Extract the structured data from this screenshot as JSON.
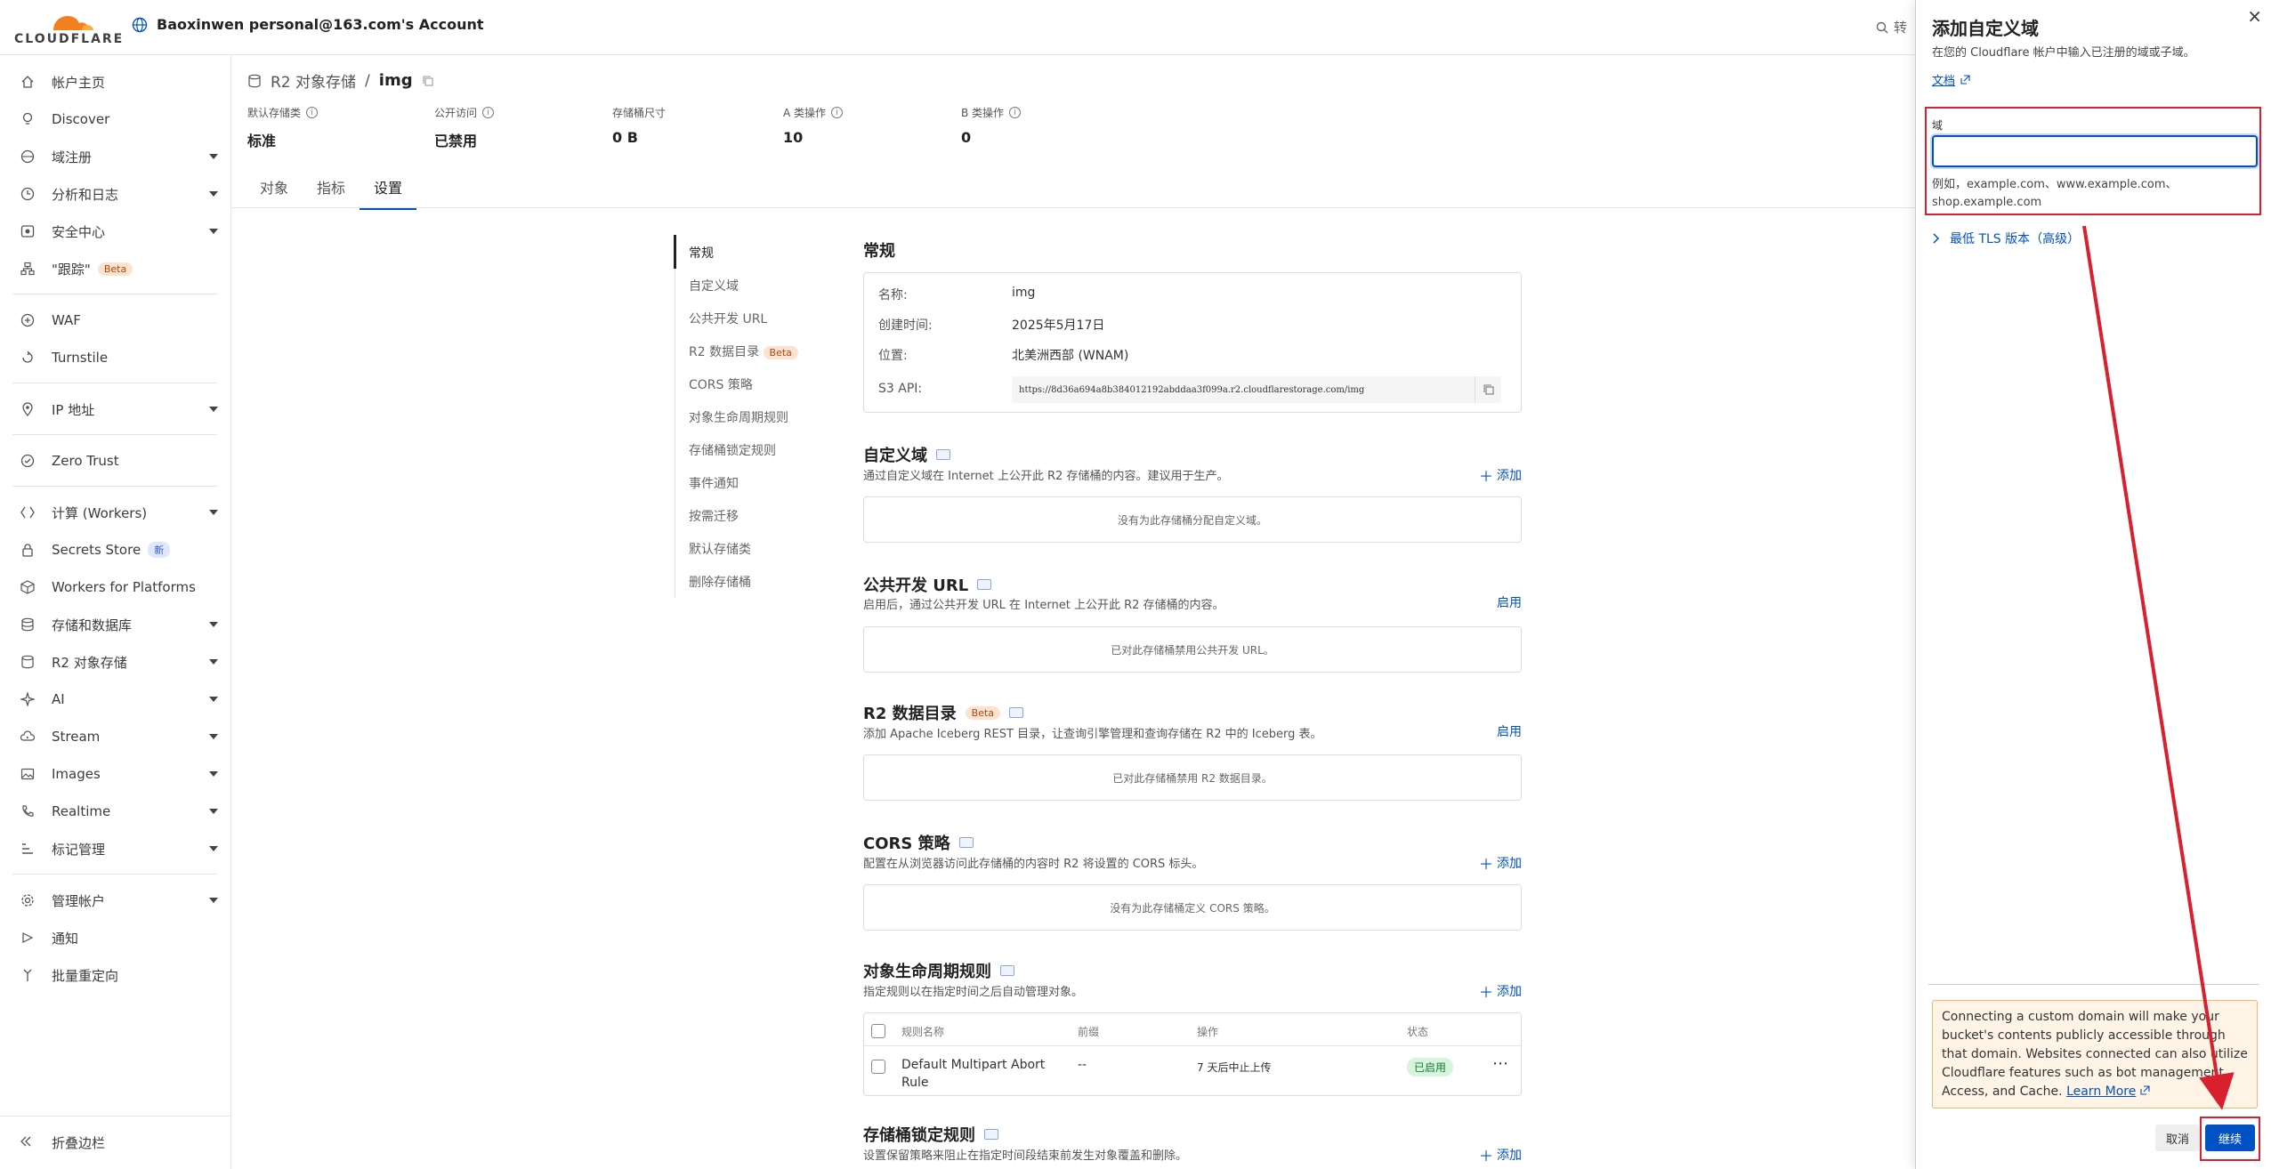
{
  "header": {
    "logo_text": "CLOUDFLARE",
    "account": "Baoxinwen personal@163.com's Account",
    "search_stub": "转"
  },
  "sidebar": {
    "items": [
      {
        "label": "帐户主页"
      },
      {
        "label": "Discover"
      },
      {
        "label": "域注册"
      },
      {
        "label": "分析和日志"
      },
      {
        "label": "安全中心"
      },
      {
        "label": "\"跟踪\"",
        "badge": "Beta"
      },
      {
        "label": "WAF"
      },
      {
        "label": "Turnstile"
      },
      {
        "label": "IP 地址"
      },
      {
        "label": "Zero Trust"
      },
      {
        "label": "计算 (Workers)"
      },
      {
        "label": "Secrets Store",
        "badge": "新"
      },
      {
        "label": "Workers for Platforms"
      },
      {
        "label": "存储和数据库"
      },
      {
        "label": "R2 对象存储"
      },
      {
        "label": "AI"
      },
      {
        "label": "Stream"
      },
      {
        "label": "Images"
      },
      {
        "label": "Realtime"
      },
      {
        "label": "标记管理"
      },
      {
        "label": "管理帐户"
      },
      {
        "label": "通知"
      },
      {
        "label": "批量重定向"
      }
    ],
    "collapse_label": "折叠边栏"
  },
  "bucket": {
    "breadcrumb_root": "R2 对象存储",
    "breadcrumb_sep": "/",
    "name": "img",
    "stats": [
      {
        "label": "默认存储类",
        "value": "标准"
      },
      {
        "label": "公开访问",
        "value": "已禁用"
      },
      {
        "label": "存储桶尺寸",
        "value": "0 B"
      },
      {
        "label": "A 类操作",
        "value": "10"
      },
      {
        "label": "B 类操作",
        "value": "0"
      }
    ],
    "tabs": [
      {
        "label": "对象"
      },
      {
        "label": "指标"
      },
      {
        "label": "设置"
      }
    ]
  },
  "settings_nav": [
    {
      "label": "常规"
    },
    {
      "label": "自定义域"
    },
    {
      "label": "公共开发 URL"
    },
    {
      "label": "R2 数据目录",
      "badge": "Beta"
    },
    {
      "label": "CORS 策略"
    },
    {
      "label": "对象生命周期规则"
    },
    {
      "label": "存储桶锁定规则"
    },
    {
      "label": "事件通知"
    },
    {
      "label": "按需迁移"
    },
    {
      "label": "默认存储类"
    },
    {
      "label": "删除存储桶"
    }
  ],
  "general": {
    "title": "常规",
    "name_label": "名称:",
    "name_value": "img",
    "created_label": "创建时间:",
    "created_value": "2025年5月17日",
    "location_label": "位置:",
    "location_value": "北美洲西部 (WNAM)",
    "s3_label": "S3 API:",
    "s3_value": "https://8d36a694a8b384012192abddaa3f099a.r2.cloudflarestorage.com/img"
  },
  "sections": {
    "custom_domain": {
      "title": "自定义域",
      "desc": "通过自定义域在 Internet 上公开此 R2 存储桶的内容。建议用于生产。",
      "action": "添加",
      "empty": "没有为此存储桶分配自定义域。"
    },
    "public_url": {
      "title": "公共开发 URL",
      "desc": "启用后，通过公共开发 URL 在 Internet 上公开此 R2 存储桶的内容。",
      "action": "启用",
      "empty": "已对此存储桶禁用公共开发 URL。"
    },
    "data_catalog": {
      "title": "R2 数据目录",
      "badge": "Beta",
      "desc": "添加 Apache Iceberg REST 目录，让查询引擎管理和查询存储在 R2 中的 Iceberg 表。",
      "action": "启用",
      "empty": "已对此存储桶禁用 R2 数据目录。"
    },
    "cors": {
      "title": "CORS 策略",
      "desc": "配置在从浏览器访问此存储桶的内容时 R2 将设置的 CORS 标头。",
      "action": "添加",
      "empty": "没有为此存储桶定义 CORS 策略。"
    },
    "lifecycle": {
      "title": "对象生命周期规则",
      "desc": "指定规则以在指定时间之后自动管理对象。",
      "action": "添加",
      "columns": [
        "规则名称",
        "前缀",
        "操作",
        "状态"
      ],
      "rows": [
        {
          "name": "Default Multipart Abort Rule",
          "prefix": "--",
          "action": "7 天后中止上传",
          "status": "已启用"
        }
      ]
    },
    "lock": {
      "title": "存储桶锁定规则",
      "desc": "设置保留策略来阻止在指定时间段结束前发生对象覆盖和删除。",
      "action": "添加"
    }
  },
  "drawer": {
    "title": "添加自定义域",
    "close": "×",
    "desc": "在您的 Cloudflare 帐户中输入已注册的域或子域。",
    "doc_link": "文档",
    "field_label": "域",
    "input_value": "",
    "hint": "例如，example.com、www.example.com、shop.example.com",
    "tls_toggle": "最低 TLS 版本（高级）",
    "warning": "Connecting a custom domain will make your bucket's contents publicly accessible through that domain. Websites connected can also utilize Cloudflare features such as bot management, Access, and Cache.",
    "learn_more": "Learn More",
    "cancel": "取消",
    "continue": "继续"
  },
  "colors": {
    "accent": "#0051c3",
    "annotation": "#d9202f",
    "brand_orange": "#f38020"
  }
}
